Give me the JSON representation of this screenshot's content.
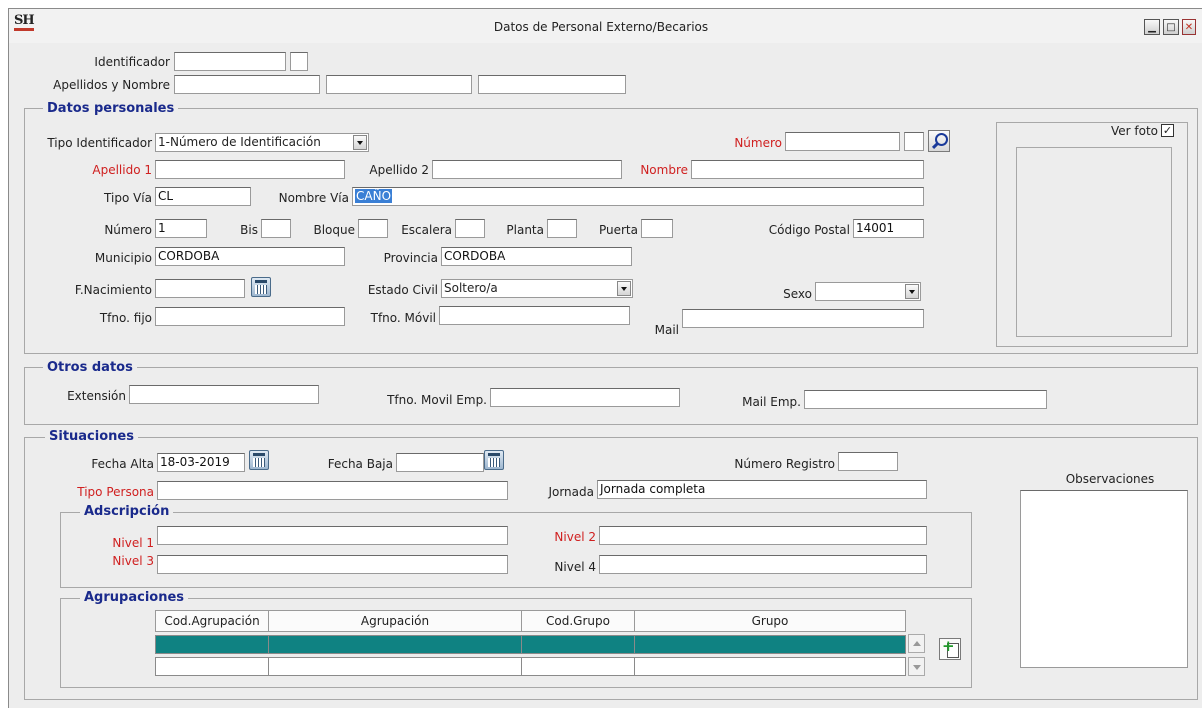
{
  "window": {
    "title": "Datos de Personal Externo/Becarios",
    "app_icon_text": "SH"
  },
  "header": {
    "identificador_label": "Identificador",
    "identificador_value": "",
    "apellidos_label": "Apellidos y Nombre"
  },
  "personales": {
    "title": "Datos personales",
    "tipo_id_label": "Tipo Identificador",
    "tipo_id_value": "1-Número de Identificación",
    "numero_id_label": "Número",
    "apellido1_label": "Apellido 1",
    "apellido2_label": "Apellido 2",
    "nombre_label": "Nombre",
    "tipo_via_label": "Tipo Vía",
    "tipo_via_value": "CL",
    "nombre_via_label": "Nombre Vía",
    "nombre_via_value": "CAÑO",
    "numero_label": "Número",
    "numero_value": "1",
    "bis_label": "Bis",
    "bloque_label": "Bloque",
    "escalera_label": "Escalera",
    "planta_label": "Planta",
    "puerta_label": "Puerta",
    "cp_label": "Código Postal",
    "cp_value": "14001",
    "municipio_label": "Municipio",
    "municipio_value": "CORDOBA",
    "provincia_label": "Provincia",
    "provincia_value": "CORDOBA",
    "fnac_label": "F.Nacimiento",
    "estado_civil_label": "Estado Civil",
    "estado_civil_value": "Soltero/a",
    "sexo_label": "Sexo",
    "sexo_value": "",
    "tfno_fijo_label": "Tfno. fijo",
    "tfno_movil_label": "Tfno. Móvil",
    "mail_label": "Mail",
    "ver_foto_label": "Ver foto",
    "ver_foto_checked": "✓"
  },
  "otros": {
    "title": "Otros datos",
    "extension_label": "Extensión",
    "movil_emp_label": "Tfno. Movil Emp.",
    "mail_emp_label": "Mail Emp."
  },
  "situaciones": {
    "title": "Situaciones",
    "fecha_alta_label": "Fecha Alta",
    "fecha_alta_value": "18-03-2019",
    "fecha_baja_label": "Fecha Baja",
    "numero_registro_label": "Número Registro",
    "tipo_persona_label": "Tipo Persona",
    "jornada_label": "Jornada",
    "jornada_value": "Jornada completa",
    "observaciones_label": "Observaciones",
    "adscripcion": {
      "title": "Adscripción",
      "nivel1_label": "Nivel 1",
      "nivel2_label": "Nivel 2",
      "nivel3_label": "Nivel 3",
      "nivel4_label": "Nivel 4"
    },
    "agrupaciones": {
      "title": "Agrupaciones",
      "columns": [
        "Cod.Agrupación",
        "Agrupación",
        "Cod.Grupo",
        "Grupo"
      ]
    }
  },
  "colors": {
    "section_title": "#1a2a8c",
    "required_label": "#d02020",
    "row_selected": "#0f8282",
    "selection": "#3a7fd5"
  }
}
